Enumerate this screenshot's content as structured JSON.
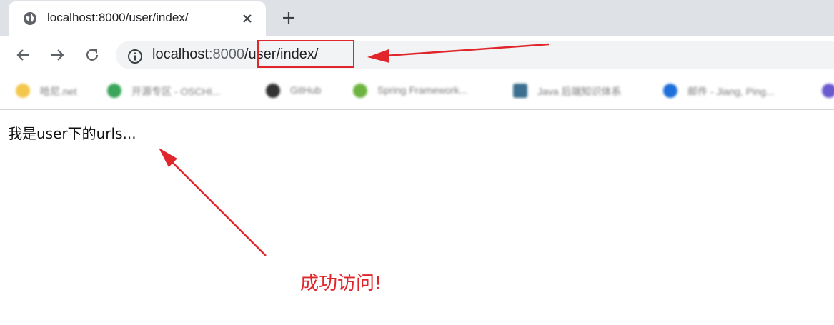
{
  "tab": {
    "title": "localhost:8000/user/index/"
  },
  "address_bar": {
    "host": "localhost",
    "port": ":8000",
    "path": "/user/index/"
  },
  "bookmarks": [
    {
      "label": "哈尼.net",
      "color": "#f3c74b"
    },
    {
      "label": "开源专区 - OSCHI...",
      "color": "#3aa55b"
    },
    {
      "label": "GitHub",
      "color": "#333333"
    },
    {
      "label": "Spring Framework...",
      "color": "#6db33f"
    },
    {
      "label": "Java 后端知识体系",
      "color": "#3b6e8f"
    },
    {
      "label": "邮件 - Jiang, Ping...",
      "color": "#1e6fd9"
    }
  ],
  "page": {
    "text": "我是user下的urls..."
  },
  "annotation": {
    "text": "成功访问!",
    "color": "#e0262b"
  },
  "icons": {
    "tab": "globe-icon",
    "close": "close-icon",
    "new_tab": "plus-icon",
    "back": "back-arrow-icon",
    "forward": "forward-arrow-icon",
    "reload": "reload-icon",
    "site_info": "info-icon"
  }
}
